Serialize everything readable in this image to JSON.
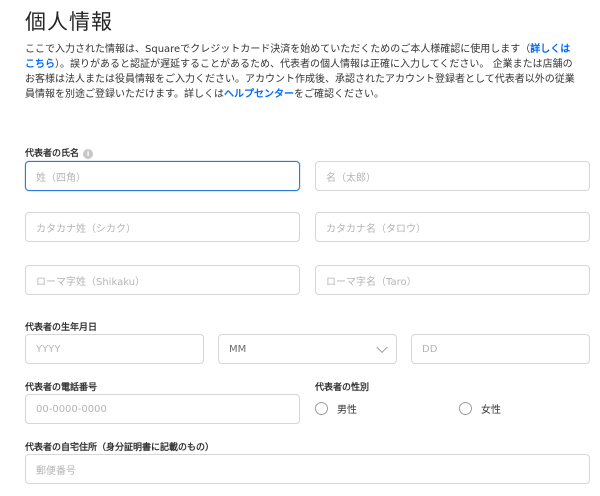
{
  "page": {
    "title": "個人情報",
    "description": {
      "part1": "ここで入力された情報は、Squareでクレジットカード決済を始めていただくためのご本人様確認に使用します（",
      "link1": "詳しくはこちら",
      "part2": "）。誤りがあると認証が遅延することがあるため、代表者の個人情報は正確に入力してください。 企業または店舗のお客様は法人または役員情報をご入力ください。アカウント作成後、承認されたアカウント登録者として代表者以外の従業員情報を別途ご登録いただけます。詳しくは",
      "link2": "ヘルプセンター",
      "part3": "をご確認ください。"
    }
  },
  "form": {
    "name_label": "代表者の氏名",
    "info_icon_glyph": "i",
    "last_name_placeholder": "姓（四角）",
    "first_name_placeholder": "名（太郎）",
    "last_name_kana_placeholder": "カタカナ姓（シカク）",
    "first_name_kana_placeholder": "カタカナ名（タロウ）",
    "last_name_roman_placeholder": "ローマ字姓（Shikaku）",
    "first_name_roman_placeholder": "ローマ字名（Taro）",
    "dob_label": "代表者の生年月日",
    "year_placeholder": "YYYY",
    "month_value": "MM",
    "day_placeholder": "DD",
    "phone_label": "代表者の電話番号",
    "phone_placeholder": "00-0000-0000",
    "gender_label": "代表者の性別",
    "gender_male": "男性",
    "gender_female": "女性",
    "address_label": "代表者の自宅住所（身分証明書に記載のもの）",
    "postal_placeholder": "郵便番号"
  }
}
